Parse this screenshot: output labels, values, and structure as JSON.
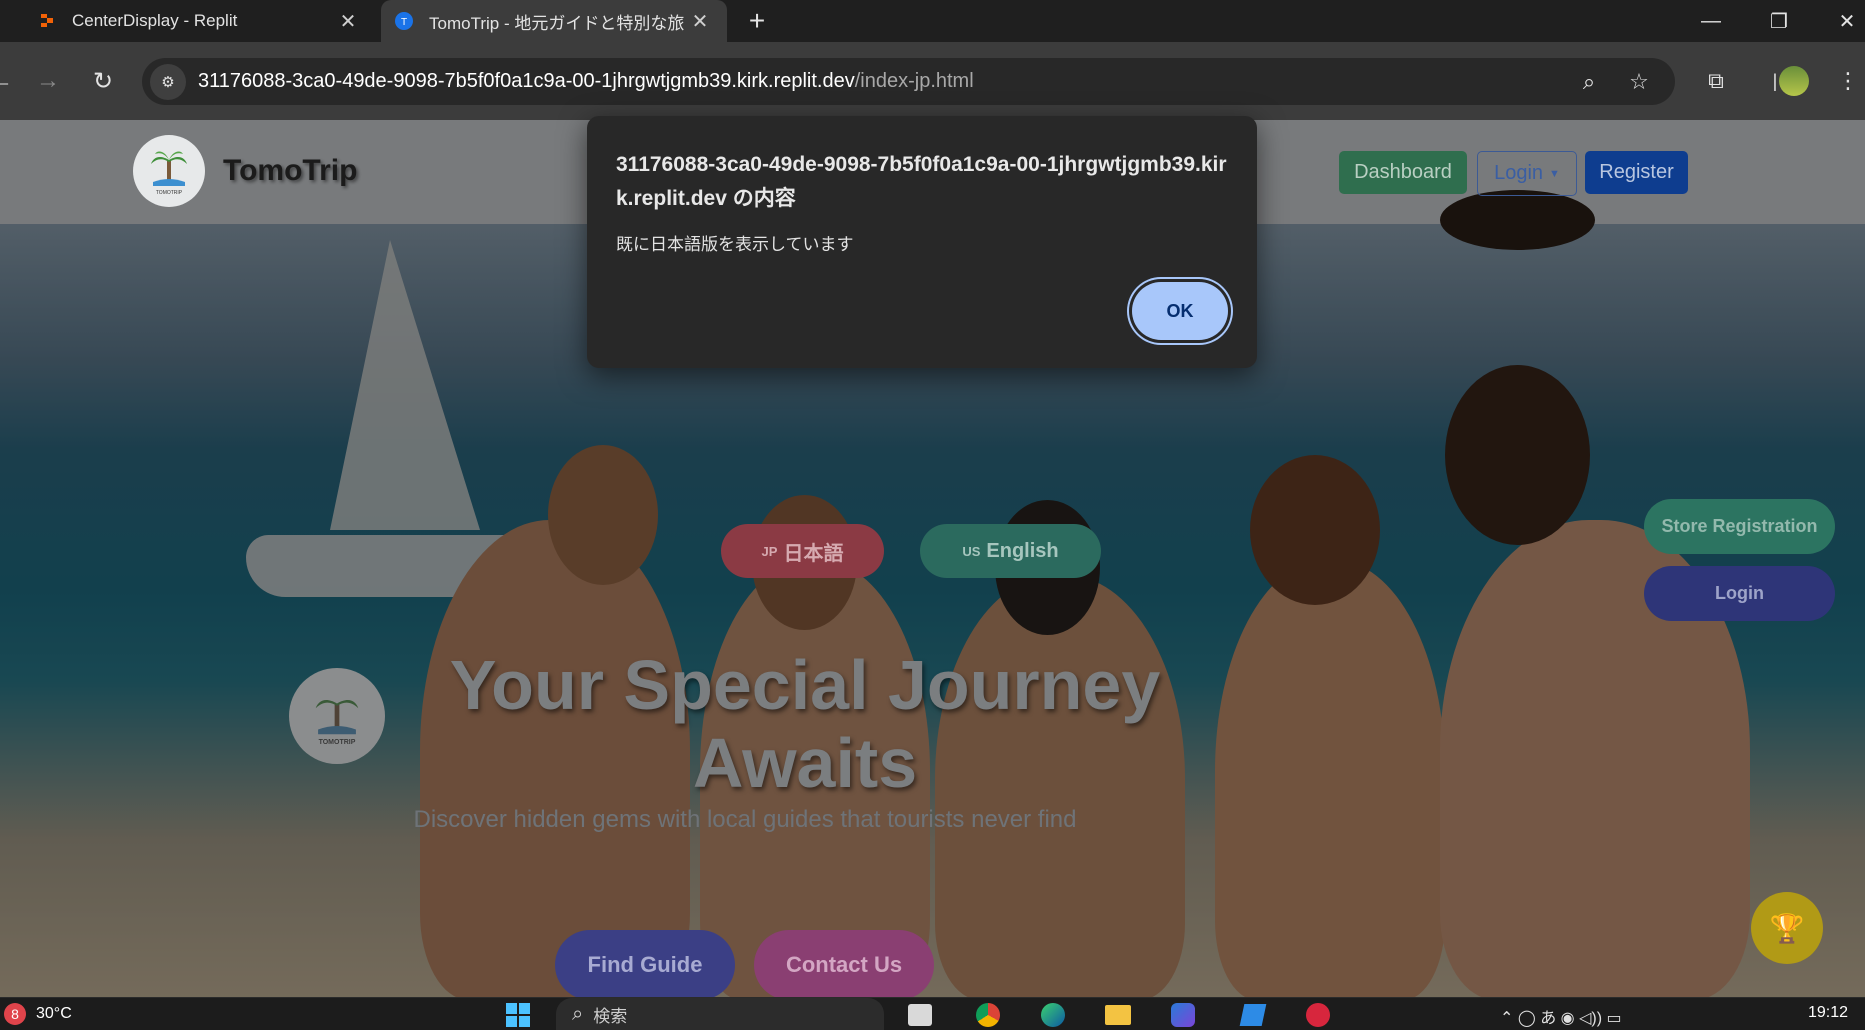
{
  "browser": {
    "tabs": [
      {
        "title": "CenterDisplay - Replit",
        "active": false
      },
      {
        "title": "TomoTrip - 地元ガイドと特別な旅",
        "active": true
      }
    ],
    "new_tab": "+",
    "url_host": "31176088-3ca0-49de-9098-7b5f0f0a1c9a-00-1jhrgwtjgmb39.kirk.replit.dev",
    "url_path": "/index-jp.html"
  },
  "site": {
    "name": "TomoTrip",
    "logo_text": "TOMOTRIP",
    "header": {
      "dashboard": "Dashboard",
      "login": "Login",
      "register": "Register"
    },
    "lang": {
      "jp_code": "JP",
      "jp_label": "日本語",
      "en_code": "US",
      "en_label": "English"
    },
    "side": {
      "store_registration": "Store Registration",
      "login": "Login"
    },
    "hero": {
      "title_line1": "Your Special Journey",
      "title_line2": "Awaits",
      "subtitle": "Discover hidden gems with local guides that tourists never find"
    },
    "cta": {
      "find_guide": "Find Guide",
      "contact_us": "Contact Us"
    }
  },
  "dialog": {
    "title": "31176088-3ca0-49de-9098-7b5f0f0a1c9a-00-1jhrgwtjgmb39.kirk.replit.dev の内容",
    "message": "既に日本語版を表示しています",
    "ok": "OK"
  },
  "taskbar": {
    "weather_badge": "8",
    "temperature": "30°C",
    "search_placeholder": "検索",
    "time": "19:12"
  },
  "colors": {
    "dialog_bg": "#282828",
    "ok_button": "#a8c7fa",
    "toolbar_bg": "#3c3c3c",
    "tab_strip_bg": "#1f1f1f"
  }
}
